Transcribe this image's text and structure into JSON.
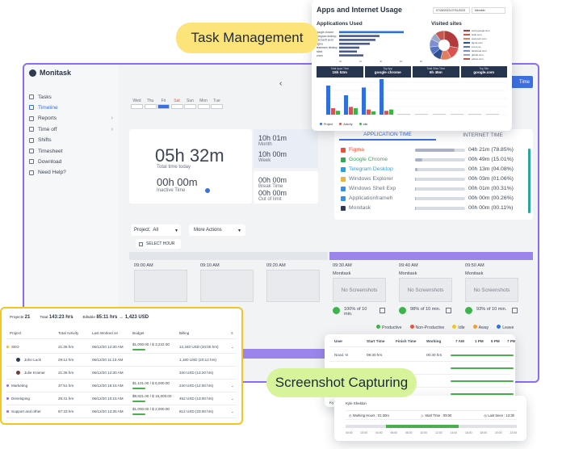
{
  "main_app": {
    "brand": "Monitask",
    "nav": [
      {
        "label": "Tasks"
      },
      {
        "label": "Timeline"
      },
      {
        "label": "Reports"
      },
      {
        "label": "Time off"
      },
      {
        "label": "Shifts"
      },
      {
        "label": "Timesheet"
      },
      {
        "label": "Download"
      },
      {
        "label": "Need Help?"
      }
    ],
    "calendar_days": [
      "Wed",
      "Thu",
      "Fri",
      "Sat",
      "Sun",
      "Mon",
      "Tue"
    ],
    "stats": {
      "total_time": "05h 32m",
      "total_time_label": "Total time today",
      "inactive_time": "00h 00m",
      "inactive_label": "Inactive Time",
      "month_value": "10h 01m",
      "month_label": "Month",
      "week_value": "10h 00m",
      "week_label": "Week",
      "break_value": "00h 00m",
      "break_label": "Break Time",
      "limit_value": "00h 00m",
      "limit_label": "Out of limit"
    },
    "tabs": {
      "application": "APPLICATION TIME",
      "internet": "INTERNET TIME"
    },
    "apps": [
      {
        "name": "Figma",
        "time": "04h 21m (78.85%)",
        "pct": 78.85,
        "color": "#e5533c"
      },
      {
        "name": "Google Chrome",
        "time": "00h 49m (15.01%)",
        "pct": 15.01,
        "color": "#34a853"
      },
      {
        "name": "Telegram Desktop",
        "time": "00h 13m (04.08%)",
        "pct": 4.08,
        "color": "#2ba0e0"
      },
      {
        "name": "Windows Explorer",
        "time": "00h 03m (01.06%)",
        "pct": 1.06,
        "color": "#f0b23c"
      },
      {
        "name": "Windows Shell Exp",
        "time": "00h 01m (00.31%)",
        "pct": 0.31,
        "color": "#3a8ee6"
      },
      {
        "name": "Applicationframeh",
        "time": "00h 00m (00.26%)",
        "pct": 0.26,
        "color": "#3a8ee6"
      },
      {
        "name": "Monitask",
        "time": "00h 00m (00.11%)",
        "pct": 0.11,
        "color": "#2d3a4f"
      }
    ],
    "project_label": "Project:",
    "project_value": "All",
    "more_actions": "More Actions",
    "select_hour": "SELECT HOUR",
    "time_slots": [
      "09:00 AM",
      "09:10 AM",
      "09:20 AM",
      "09:30 AM",
      "09:40 AM",
      "09:50 AM"
    ],
    "slot_app": "Monitask",
    "no_screenshots": "No Screenshots",
    "activity": [
      {
        "label": "100% of 10 min."
      },
      {
        "label": "98% of 10 min."
      },
      {
        "label": "93% of 10 min."
      }
    ],
    "legend": [
      {
        "label": "Productive",
        "color": "#3cb44b"
      },
      {
        "label": "Non-Productive",
        "color": "#e5533c"
      },
      {
        "label": "Idle",
        "color": "#f3c623"
      },
      {
        "label": "Away",
        "color": "#f39c3c"
      },
      {
        "label": "Leave",
        "color": "#2f6fe0"
      }
    ],
    "top_button": "Time"
  },
  "usage_panel": {
    "title": "Apps and Internet Usage",
    "date_range": "07/28/2023-07/31/2023",
    "filter": "Member",
    "apps_title": "Applications Used",
    "sites_title": "Visited sites",
    "app_rows": [
      "google chrome",
      "telegram desktop",
      "microsoft word",
      "figma",
      "teamwork desktop",
      "slack",
      "zoom"
    ],
    "app_values": [
      80,
      50,
      45,
      38,
      25,
      22,
      30
    ],
    "site_rows": [
      "www.google.com",
      "slido.com",
      "www.sort.com",
      "figma.com",
      "zoom.us",
      "facebook.com",
      "github.com",
      "yahoo.com"
    ],
    "site_values": [
      28,
      14,
      12,
      10,
      9,
      9,
      8,
      10
    ],
    "site_colors": [
      "#b23a3a",
      "#d9534f",
      "#e27d60",
      "#2f4f8f",
      "#5873c2",
      "#7d8fd1",
      "#9aa7c7",
      "#c6554c"
    ],
    "x_ticks": [
      "0h",
      "2h",
      "4h",
      "6h",
      "8h"
    ],
    "summary": [
      {
        "label": "Total Apps Time",
        "value": "15h 53m"
      },
      {
        "label": "Top App",
        "value": "google chrome"
      },
      {
        "label": "Total Sites Time",
        "value": "6h 45m"
      },
      {
        "label": "Top Site",
        "value": "google.com"
      }
    ],
    "bars_blue": [
      45,
      30,
      42,
      55,
      0,
      0,
      0,
      0,
      0,
      0
    ],
    "bars_red": [
      10,
      12,
      8,
      6,
      0,
      0,
      0,
      0,
      0,
      0
    ],
    "bars_green": [
      6,
      10,
      5,
      8,
      0,
      0,
      0,
      0,
      0,
      0
    ],
    "legend": [
      {
        "label": "Project",
        "color": "#2f6fe0"
      },
      {
        "label": "Activity",
        "color": "#d9534f"
      },
      {
        "label": "Idle",
        "color": "#3cb44b"
      }
    ]
  },
  "pills": {
    "task": "Task Management",
    "screenshot": "Screenshot Capturing"
  },
  "project_panel": {
    "projects_label": "Projects",
    "projects_count": "21",
    "total_label": "Total",
    "total_value": "143:23 hrs",
    "billable_label": "Billable",
    "billable_value": "85:11 hrs → 1,423 USD",
    "headers": [
      "Project",
      "Total Activity",
      "Last Worked on",
      "Budget",
      "Billing"
    ],
    "rows": [
      {
        "project": "SEO",
        "activity": "21:36 hrs",
        "last": "06/12/20 12:30 AM",
        "budget": "$1,000.00 / $ 3,222.00",
        "billing": "12,340 USD (34:00 hrs)",
        "indent": false,
        "dot": "#f0b23c"
      },
      {
        "project": "John Luck",
        "activity": "29:12 hrs",
        "last": "06/12/20 11:13 AM",
        "budget": "",
        "billing": "1,180 USD (20:12 hrs)",
        "indent": true,
        "dot": "#2d3a4f"
      },
      {
        "project": "Julie Kramer",
        "activity": "21:36 hrs",
        "last": "06/12/20 12:30 AM",
        "budget": "",
        "billing": "340 USD (13:20 hrs)",
        "indent": true,
        "dot": "#6b3f3f"
      },
      {
        "project": "Marketing",
        "activity": "37:51 hrs",
        "last": "06/12/20 16:15 AM",
        "budget": "$1,101.00 / $ 6,000.00",
        "billing": "240 USD (12:00 hrs)",
        "indent": false,
        "dot": "#8a6cf2"
      },
      {
        "project": "Developing",
        "activity": "26:41 hrs",
        "last": "06/12/20 10:15 AM",
        "budget": "$9,821.00 / $ 15,000.00",
        "billing": "452 USD (13:00 hrs)",
        "indent": false,
        "dot": "#8a6cf2"
      },
      {
        "project": "Support and other",
        "activity": "67:33 hrs",
        "last": "06/12/20 12:35 AM",
        "budget": "$1,000.00 / $ 2,000.00",
        "billing": "812 USD (23:00 hrs)",
        "indent": false,
        "dot": "#8a6cf2"
      }
    ]
  },
  "attendance_panel": {
    "headers": [
      "User",
      "Start Time",
      "Finish Time",
      "Working",
      "7 AM",
      "1 PM",
      "5 PM",
      "7 PM"
    ],
    "rows": [
      {
        "user": "Nood. N",
        "start": "09:30 hrs",
        "finish": "",
        "working": "00:30 hrs"
      },
      {
        "user": "",
        "start": "",
        "finish": "",
        "working": ""
      },
      {
        "user": "",
        "start": "",
        "finish": "",
        "working": ""
      },
      {
        "user": "",
        "start": "",
        "finish": "",
        "working": ""
      }
    ],
    "footer_user": "Ky"
  },
  "detail_panel": {
    "user": "Kyle Sheldon",
    "working": "Working Hours : 01:30m",
    "start": "Start Time : 09:00",
    "last": "Last Seen : 12:30",
    "ticks": [
      "00:00",
      "02:00",
      "04:00",
      "06:00",
      "08:00",
      "10:00",
      "12:00",
      "14:00",
      "16:00",
      "18:00",
      "20:00",
      "22:00"
    ]
  }
}
